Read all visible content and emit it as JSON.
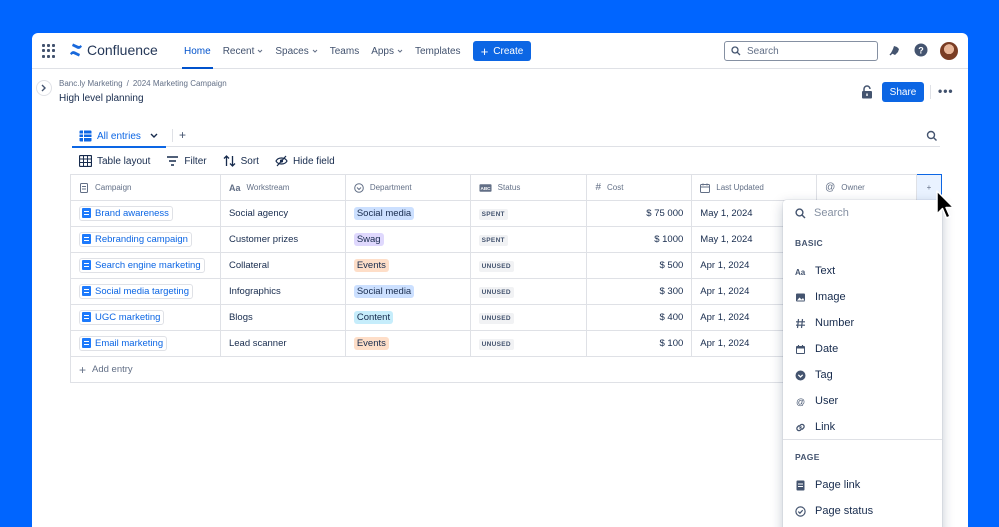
{
  "app": {
    "name": "Confluence"
  },
  "nav": {
    "items": [
      {
        "label": "Home",
        "active": true,
        "dropdown": false
      },
      {
        "label": "Recent",
        "active": false,
        "dropdown": true
      },
      {
        "label": "Spaces",
        "active": false,
        "dropdown": true
      },
      {
        "label": "Teams",
        "active": false,
        "dropdown": false
      },
      {
        "label": "Apps",
        "active": false,
        "dropdown": true
      },
      {
        "label": "Templates",
        "active": false,
        "dropdown": false
      }
    ],
    "create_label": "Create",
    "search_placeholder": "Search"
  },
  "page": {
    "breadcrumb": [
      "Banc.ly Marketing",
      "2024 Marketing Campaign"
    ],
    "breadcrumb_sep": "/",
    "title": "High level planning",
    "share_label": "Share"
  },
  "database": {
    "view_label": "All entries",
    "tools": {
      "layout": "Table layout",
      "filter": "Filter",
      "sort": "Sort",
      "hide": "Hide field"
    },
    "columns": [
      "Campaign",
      "Workstream",
      "Department",
      "Status",
      "Cost",
      "Last Updated",
      "Owner"
    ],
    "rows": [
      {
        "campaign": "Brand awareness",
        "workstream": "Social agency",
        "department": "Social media",
        "dept_color": "#cce0ff",
        "status": "SPENT",
        "cost": "$ 75 000",
        "updated": "May 1, 2024"
      },
      {
        "campaign": "Rebranding campaign",
        "workstream": "Customer prizes",
        "department": "Swag",
        "dept_color": "#dfd8fd",
        "status": "SPENT",
        "cost": "$ 1000",
        "updated": "May 1, 2024"
      },
      {
        "campaign": "Search engine marketing",
        "workstream": "Collateral",
        "department": "Events",
        "dept_color": "#fedec8",
        "status": "UNUSED",
        "cost": "$ 500",
        "updated": "Apr 1, 2024"
      },
      {
        "campaign": "Social media targeting",
        "workstream": "Infographics",
        "department": "Social media",
        "dept_color": "#cce0ff",
        "status": "UNUSED",
        "cost": "$ 300",
        "updated": "Apr 1, 2024"
      },
      {
        "campaign": "UGC marketing",
        "workstream": "Blogs",
        "department": "Content",
        "dept_color": "#c6edfb",
        "status": "UNUSED",
        "cost": "$ 400",
        "updated": "Apr 1, 2024"
      },
      {
        "campaign": "Email marketing",
        "workstream": "Lead scanner",
        "department": "Events",
        "dept_color": "#fedec8",
        "status": "UNUSED",
        "cost": "$ 100",
        "updated": "Apr 1, 2024"
      }
    ],
    "add_entry_label": "Add entry"
  },
  "field_menu": {
    "search_placeholder": "Search",
    "basic_heading": "BASIC",
    "basic_items": [
      {
        "label": "Text",
        "icon": "text-icon"
      },
      {
        "label": "Image",
        "icon": "image-icon"
      },
      {
        "label": "Number",
        "icon": "number-icon"
      },
      {
        "label": "Date",
        "icon": "date-icon"
      },
      {
        "label": "Tag",
        "icon": "tag-icon"
      },
      {
        "label": "User",
        "icon": "user-icon"
      },
      {
        "label": "Link",
        "icon": "link-icon"
      }
    ],
    "page_heading": "PAGE",
    "page_items": [
      {
        "label": "Page link",
        "icon": "page-link-icon"
      },
      {
        "label": "Page status",
        "icon": "page-status-icon"
      }
    ]
  },
  "colors": {
    "accent": "#0c66e4",
    "background": "#0065ff"
  }
}
